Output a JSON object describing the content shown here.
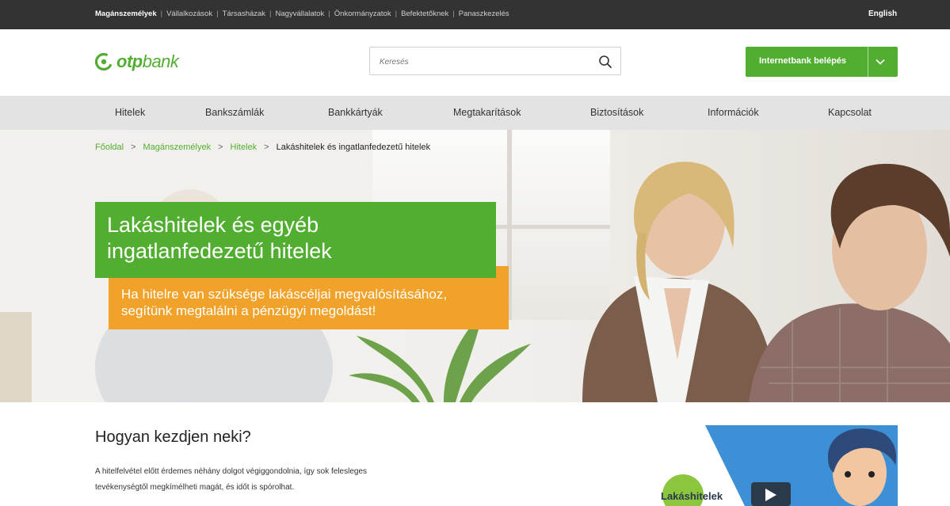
{
  "topbar": {
    "segments": [
      {
        "label": "Magánszemélyek",
        "active": true
      },
      {
        "label": "Vállalkozások",
        "active": false
      },
      {
        "label": "Társasházak",
        "active": false
      },
      {
        "label": "Nagyvállalatok",
        "active": false
      },
      {
        "label": "Önkormányzatok",
        "active": false
      },
      {
        "label": "Befektetőknek",
        "active": false
      },
      {
        "label": "Panaszkezelés",
        "active": false
      }
    ],
    "separator": "|",
    "language": "English"
  },
  "header": {
    "logo": {
      "bold": "otp",
      "light": "bank",
      "icon": "otp-logo-icon"
    },
    "search": {
      "placeholder": "Keresés",
      "value": "",
      "icon": "search-icon"
    },
    "netbank": {
      "label": "Internetbank belépés",
      "icon": "chevron-down-icon"
    }
  },
  "nav": {
    "items": [
      "Hitelek",
      "Bankszámlák",
      "Bankkártyák",
      "Megtakarítások",
      "Biztosítások",
      "Információk",
      "Kapcsolat"
    ]
  },
  "breadcrumb": {
    "items": [
      "Főoldal",
      "Magánszemélyek",
      "Hitelek",
      "Lakáshitelek és ingatlanfedezetű hitelek"
    ],
    "separator": ">"
  },
  "hero": {
    "title_line1": "Lakáshitelek és egyéb",
    "title_line2": "ingatlanfedezetű hitelek",
    "subtitle_line1": "Ha hitelre van szüksége lakáscéljai megvalósításához,",
    "subtitle_line2": "segítünk megtalálni a pénzügyi megoldást!"
  },
  "content": {
    "heading": "Hogyan kezdjen neki?",
    "paragraph_line1": "A hitelfelvétel előtt érdemes néhány dolgot végiggondolnia, így sok felesleges",
    "paragraph_line2": "tevékenységtől megkímélheti magát, és időt is spórolhat.",
    "video_label": "Lakáshitelek"
  },
  "colors": {
    "brand_green": "#52ae30",
    "accent_orange": "#f0a22a",
    "topbar_bg": "#333333",
    "nav_bg": "#e3e3e3"
  }
}
